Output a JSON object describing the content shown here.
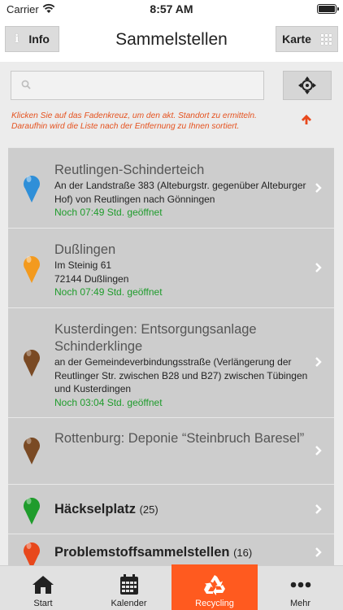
{
  "status_bar": {
    "carrier": "Carrier",
    "time": "8:57 AM"
  },
  "navbar": {
    "info_label": "Info",
    "title": "Sammelstellen",
    "map_label": "Karte"
  },
  "search": {
    "placeholder": ""
  },
  "hint": "Klicken Sie auf das Fadenkreuz, um den akt. Standort zu ermitteln. Daraufhin wird die Liste nach der Entfernung zu Ihnen sortiert.",
  "list": {
    "items": [
      {
        "title": "Reutlingen-Schinderteich",
        "address": "An der Landstraße 383 (Alteburgstr. gegenüber Alteburger Hof) von Reutlingen nach Gönningen",
        "open": "Noch 07:49 Std. geöffnet",
        "pin_color": "#2f8fd8"
      },
      {
        "title": "Dußlingen",
        "address_line1": "Im Steinig 61",
        "address_line2": "72144 Dußlingen",
        "open": "Noch 07:49 Std. geöffnet",
        "pin_color": "#f39a1e"
      },
      {
        "title": "Kusterdingen: Entsorgungsanlage Schinderklinge",
        "address": "an der Gemeindeverbindungsstraße (Verlängerung der Reutlinger Str. zwischen B28 und B27) zwischen Tübingen und Kusterdingen",
        "open": "Noch 03:04 Std. geöffnet",
        "pin_color": "#7a4a24"
      },
      {
        "title": "Rottenburg: Deponie “Steinbruch Baresel”",
        "pin_color": "#7a4a24"
      },
      {
        "title": "Häckselplatz",
        "count": "(25)",
        "pin_color": "#1f9c2c"
      },
      {
        "title": "Problemstoffsammelstellen",
        "count": "(16)",
        "pin_color": "#e8481c"
      }
    ]
  },
  "tabbar": {
    "tabs": [
      {
        "label": "Start",
        "icon": "home-icon"
      },
      {
        "label": "Kalender",
        "icon": "calendar-icon"
      },
      {
        "label": "Recycling",
        "icon": "recycle-icon",
        "active": true
      },
      {
        "label": "Mehr",
        "icon": "more-icon"
      }
    ]
  },
  "colors": {
    "accent": "#ff5a1f",
    "open_green": "#1f9c2c",
    "hint_orange": "#e5521f"
  }
}
